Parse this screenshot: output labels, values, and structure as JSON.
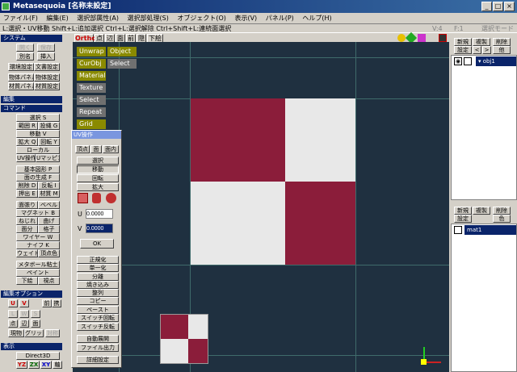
{
  "window": {
    "title": "Metasequoia [名称未設定]",
    "min": "_",
    "max": "□",
    "close": "×"
  },
  "menu": [
    "ファイル(F)",
    "編集(E)",
    "選択部属性(A)",
    "選択部処理(S)",
    "オブジェクト(O)",
    "表示(V)",
    "パネル(P)",
    "ヘルプ(H)"
  ],
  "status": {
    "text": "L:選択・UV移動  Shift+L:追加選択  Ctrl+L:選択解除  Ctrl+Shift+L:連続面選択",
    "v": "V:4",
    "f": "F:1",
    "mode": "選択モード"
  },
  "left": {
    "system_header": "システム",
    "system_buttons": [
      "開く",
      "保存",
      "別名",
      "挿入",
      "環境設定",
      "文書設定",
      "物体パネル",
      "物体設定",
      "材質パネル",
      "材質設定"
    ],
    "edit_header": "編集",
    "command_header": "コマンド",
    "command_buttons": [
      "選択 S",
      "範囲 R",
      "投縄 G",
      "移動 V",
      "拡大 Q",
      "回転 Y",
      "ローカル",
      "UV操作",
      "Uマッピング",
      "基本図形 P",
      "面の生成 F",
      "削除 D",
      "反転 I",
      "押出 E",
      "材質 M",
      "面張り",
      "ベベル",
      "マグネット B",
      "ねじれ",
      "曲げ",
      "面分",
      "格子",
      "ワイヤー W",
      "ナイフ K",
      "ウェイト",
      "頂点色",
      "メタボール粘土",
      "ペイント",
      "下絵",
      "視点"
    ],
    "editopt_header": "編集オプション",
    "editopt_buttons": [
      "U",
      "V",
      "前",
      "携",
      "L",
      "W",
      "S",
      "点",
      "辺",
      "面",
      "現物",
      "グリッド",
      "対称"
    ],
    "view_header": "表示",
    "view_buttons": [
      "Direct3D",
      "YZ",
      "ZX",
      "XY",
      "軸"
    ]
  },
  "viewtabs": [
    "Ortho",
    "点",
    "辺",
    "面",
    "前",
    "隠",
    "下絵"
  ],
  "cmdpanel": [
    "Unwrap",
    "Object",
    "CurObj",
    "Select",
    "Material",
    "Texture",
    "Select",
    "Repeat",
    "Grid"
  ],
  "uv": {
    "title": "UV操作",
    "tabs": [
      "頂点",
      "面",
      "面内"
    ],
    "buttons": [
      "選択",
      "移動",
      "回転",
      "拡大"
    ],
    "u_label": "U",
    "u_value": "0.0000",
    "v_label": "V",
    "v_value": "0.0000",
    "ok": "OK",
    "ops": [
      "正規化",
      "単一化",
      "分離",
      "焼き込み",
      "整列",
      "コピー",
      "ペースト",
      "スイッチ回転",
      "スイッチ反転",
      "自動展開",
      "ファイル出力",
      "詳細設定"
    ]
  },
  "objpanel": {
    "buttons": [
      "新規",
      "複製",
      "削除",
      "設定",
      "<",
      ">",
      "他"
    ],
    "object": "obj1"
  },
  "matpanel": {
    "buttons": [
      "新規",
      "複製",
      "削除",
      "設定",
      "色"
    ],
    "material": "mat1"
  },
  "colors": {
    "maroon": "#8b1d3a",
    "light": "#e8e8e8",
    "viewport": "#1f3040",
    "titlebar": "#0a246a"
  }
}
